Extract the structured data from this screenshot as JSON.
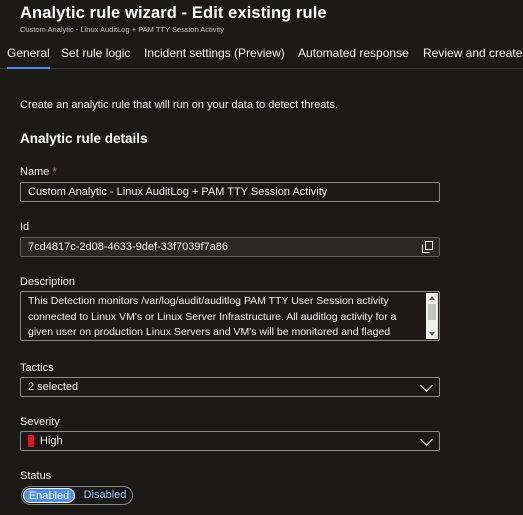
{
  "header": {
    "title": "Analytic rule wizard - Edit existing rule",
    "subtitle": "Custom Analytic - Linux AuditLog + PAM TTY Session Activity"
  },
  "tabs": [
    {
      "label": "General",
      "active": true
    },
    {
      "label": "Set rule logic",
      "active": false
    },
    {
      "label": "Incident settings (Preview)",
      "active": false
    },
    {
      "label": "Automated response",
      "active": false
    },
    {
      "label": "Review and create",
      "active": false
    }
  ],
  "intro": "Create an analytic rule that will run on your data to detect threats.",
  "section_title": "Analytic rule details",
  "form": {
    "name": {
      "label": "Name",
      "required_mark": "*",
      "value": "Custom Analytic - Linux AuditLog + PAM TTY Session Activity"
    },
    "id": {
      "label": "Id",
      "value": "7cd4817c-2d08-4633-9def-33f7039f7a86",
      "icon": "copy-icon"
    },
    "description": {
      "label": "Description",
      "lines": [
        "This Detection monitors /var/log/audit/auditlog PAM TTY User Session activity",
        "connected to Linux VM's or Linux Server Infrastructure. All auditlog activity for a",
        "given user on production Linux Servers and VM's will be monitored and flaged"
      ]
    },
    "tactics": {
      "label": "Tactics",
      "value": "2 selected",
      "icon": "chevron-down-icon"
    },
    "severity": {
      "label": "Severity",
      "value": "High",
      "color": "#e81123",
      "icon": "chevron-down-icon"
    },
    "status": {
      "label": "Status",
      "options": [
        "Enabled",
        "Disabled"
      ],
      "selected": "Enabled"
    }
  },
  "colors": {
    "background": "#1b1a19",
    "accent": "#4f8fe6",
    "severity_high": "#e81123",
    "required": "#f1707b"
  }
}
